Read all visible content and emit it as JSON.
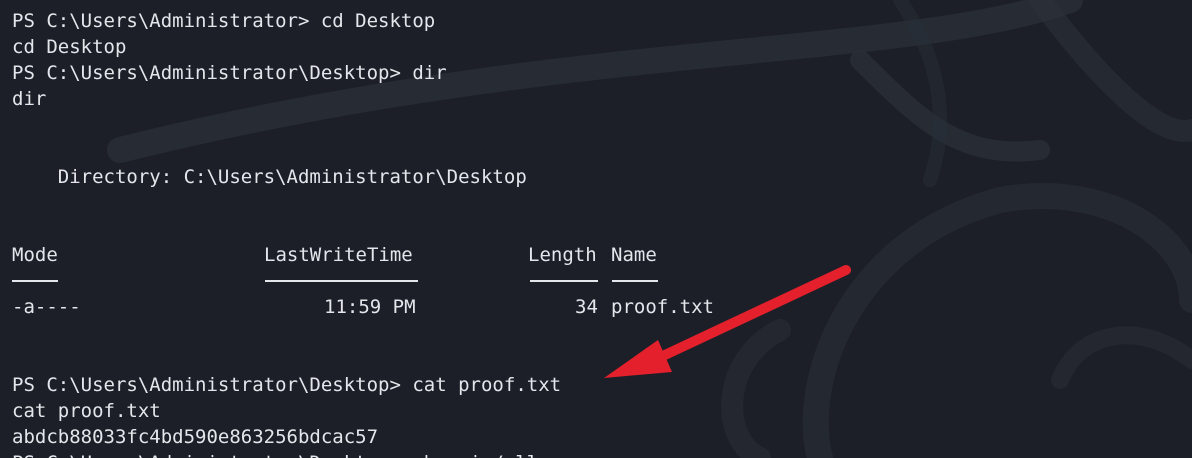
{
  "terminal": {
    "lines": [
      "PS C:\\Users\\Administrator> cd Desktop",
      "cd Desktop",
      "PS C:\\Users\\Administrator\\Desktop> dir",
      "dir",
      "    Directory: C:\\Users\\Administrator\\Desktop",
      "PS C:\\Users\\Administrator\\Desktop> cat proof.txt",
      "cat proof.txt",
      "abdcb88033fc4bd590e863256bdcac57",
      "PS C:\\Users\\Administrator\\Desktop> whoami /all"
    ],
    "table": {
      "headers": {
        "mode": "Mode",
        "lastwritetime": "LastWriteTime",
        "length": "Length",
        "name": "Name"
      },
      "row": {
        "mode": "-a----",
        "lastwritetime": "11:59 PM",
        "length": "34",
        "name": "proof.txt"
      }
    }
  },
  "colors": {
    "background": "#1c1f27",
    "text": "#e3e6ea",
    "arrow": "#e3202b"
  }
}
